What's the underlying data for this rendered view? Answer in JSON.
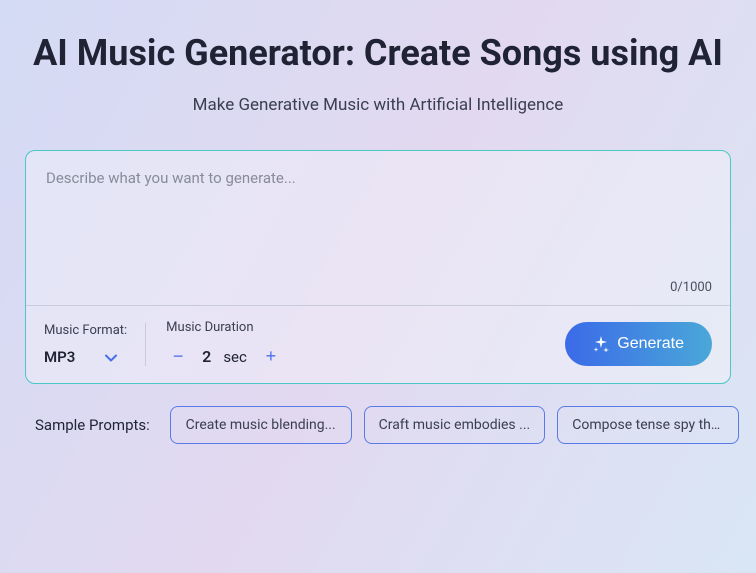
{
  "header": {
    "title": "AI Music Generator: Create Songs using AI",
    "subtitle": "Make Generative Music with Artificial Intelligence"
  },
  "input": {
    "placeholder": "Describe what you want to generate...",
    "char_count": "0/1000"
  },
  "format": {
    "label": "Music Format:",
    "value": "MP3"
  },
  "duration": {
    "label": "Music Duration",
    "value": "2",
    "unit": "sec"
  },
  "generate": {
    "label": "Generate"
  },
  "prompts": {
    "label": "Sample Prompts:",
    "items": [
      "Create music blending...",
      "Craft music embodies ...",
      "Compose tense spy thr..."
    ]
  }
}
